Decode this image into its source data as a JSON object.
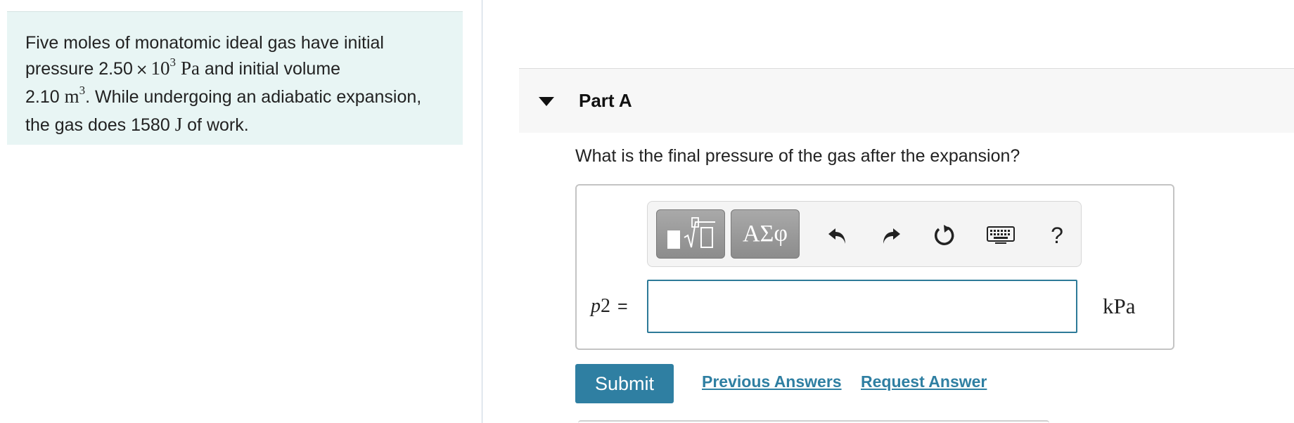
{
  "problem": {
    "line1": "Five moles of monatomic ideal gas have initial",
    "line2_pre": "pressure 2.50",
    "times": "×",
    "ten": "10",
    "exp3": "3",
    "pa": "Pa",
    "line2_post": "and initial volume",
    "vol_value": "2.10",
    "m": "m",
    "line3_post": ". While undergoing an adiabatic expansion,",
    "line4_pre": "the gas does 1580",
    "J": "J",
    "line4_post": "of work."
  },
  "part": {
    "title": "Part A",
    "question": "What is the final pressure of the gas after the expansion?"
  },
  "toolbar": {
    "greek_label": "ΑΣφ",
    "help_label": "?",
    "icons": [
      "template-icon",
      "greek-symbols",
      "undo-icon",
      "redo-icon",
      "reset-icon",
      "keyboard-icon",
      "help-icon"
    ]
  },
  "answer": {
    "variable": "p",
    "subscript": "2",
    "equals": "=",
    "value": "",
    "unit": "kPa"
  },
  "actions": {
    "submit_label": "Submit",
    "previous_answers": "Previous Answers",
    "request_answer": "Request Answer"
  },
  "colors": {
    "problem_bg": "#e8f5f4",
    "accent": "#2f7fa2",
    "input_border": "#2d7a98"
  }
}
